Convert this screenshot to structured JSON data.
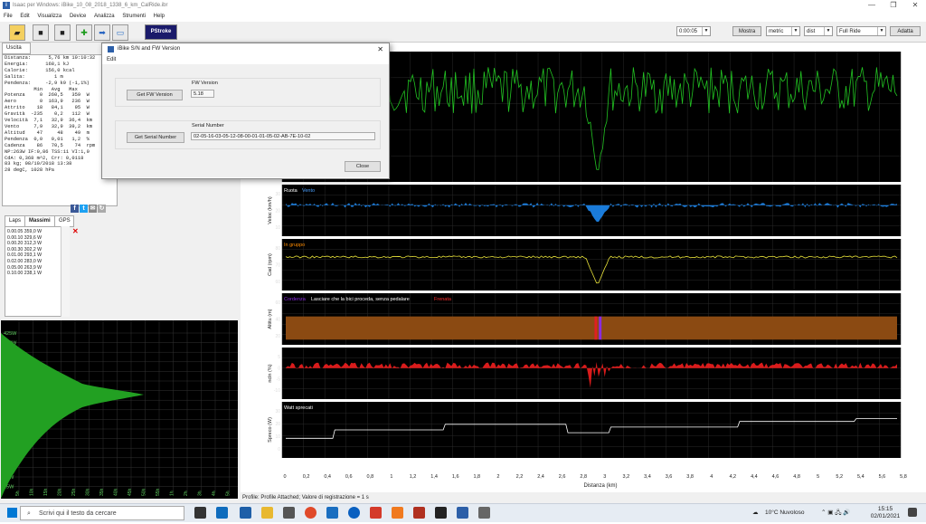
{
  "window": {
    "title": "Isaac per Windows: iBike_10_08_2018_1338_6_km_CalRide.ibr",
    "minimize": "—",
    "maximize": "❐",
    "close": "✕"
  },
  "menu": [
    "File",
    "Edit",
    "Visualizza",
    "Device",
    "Analizza",
    "Strumenti",
    "Help"
  ],
  "toolbar": {
    "pstroke_label": "PStroke",
    "time_value": "0:00:05",
    "mostra_label": "Mostra",
    "units_value": "metric",
    "axis_value": "dist",
    "range_value": "Full Ride",
    "adatta_label": "Adatta"
  },
  "left": {
    "tab_uscita": "Uscita",
    "tab_n": "N",
    "stats_lines": [
      "Distanza:      5,76 km 10:10:32",
      "Energia:      168,1 kJ",
      "Calorie:      156,0 kcal",
      "Salita:          1 m",
      "Pendenza:     -2,9 k9 (-1,1%)",
      "          Min   Avg   Max",
      "Potenza     0  260,5   359  W",
      "Aero        0  163,9   236  W",
      "Attrito    18   84,1    95  W",
      "Gravità  -235    0,2   112  W",
      "Velocità  7,1   32,9  36,4  km",
      "Vento     7,9   32,9  39,2  km",
      "Altitud    47     48    49  m",
      "Pendenza  0,0   0,01   1,2  %",
      "Cadenza    86   70,5    74  rpm",
      "NP:263W IF:0,86 TSS:11 VI:1,0",
      "CdA: 0,368 m^2, Crr: 0,0118",
      "83 kg; 08/10/2018 13:38",
      "28 degC, 1028 hPa"
    ],
    "laps_tab": "Laps",
    "massimi_tab": "Massimi",
    "gps_tab": "GPS",
    "massimi": [
      "0.00.05 359,0 W",
      "0.00.10 329,6 W",
      "0.00.20 312,3 W",
      "0.00.30 302,2 W",
      "0.01.00 293,1 W",
      "0.02.00 283,0 W",
      "0.05.00 263,9 W",
      "0.10.00 238,1 W"
    ],
    "hist_y_labels": [
      "425W",
      "400W",
      "375W",
      "350W",
      "325W",
      "300W",
      "275W",
      "250W",
      "225W",
      "200W",
      "175W",
      "150W",
      "125W",
      "100W",
      "75W",
      "50W",
      "25W"
    ],
    "hist_x_labels": [
      "5h",
      "10h",
      "15h",
      "20h",
      "25h",
      "30h",
      "35h",
      "40h",
      "45h",
      "50h",
      "55h",
      "1h",
      "2h",
      "3h",
      "4h",
      "5h"
    ]
  },
  "dialog": {
    "title": "iBike S/N and FW Version",
    "edit_menu": "Edit",
    "fw_label": "FW Version",
    "fw_button": "Get FW Version",
    "fw_value": "5.18",
    "sn_label": "Serial Number",
    "sn_button": "Get Serial Number",
    "sn_value": "02-05-16-03-05-12-08-00-01-01-05-02-AB-7E-10-02",
    "close_label": "Close"
  },
  "charts": {
    "panels": [
      {
        "ylabel": "",
        "title": "",
        "color": "#22c422"
      },
      {
        "ylabel": "Veloc (km/h)",
        "title": "Ruota",
        "title2": "Vento",
        "color": "#1e90ff",
        "ticks": [
          "30",
          "20",
          "10"
        ]
      },
      {
        "ylabel": "Cad (rpm)",
        "title": "In gruppo",
        "color": "#e8e23a",
        "ticks": [
          "80",
          "70",
          "60"
        ]
      },
      {
        "ylabel": "Altitu (m)",
        "title": "Cordenza",
        "title_mid": "Lasciare che la bici proceda, senza pedalare",
        "title_end": "Frenata",
        "color": "#8b4a12",
        "ticks": [
          "60",
          "40",
          "20"
        ]
      },
      {
        "ylabel": "ncln (%)",
        "title": "",
        "color": "#ff2020",
        "ticks": [
          "5",
          "0",
          "-5",
          "-10"
        ]
      },
      {
        "ylabel": "Spreco (W)",
        "title": "Watt sprecati",
        "color": "#ffffff",
        "ticks": [
          "30",
          "20",
          "10",
          "0"
        ]
      }
    ],
    "x_ticks": [
      "0",
      "0,2",
      "0,4",
      "0,6",
      "0,8",
      "1",
      "1,2",
      "1,4",
      "1,6",
      "1,8",
      "2",
      "2,2",
      "2,4",
      "2,6",
      "2,8",
      "3",
      "3,2",
      "3,4",
      "3,6",
      "3,8",
      "4",
      "4,2",
      "4,4",
      "4,6",
      "4,8",
      "5",
      "5,2",
      "5,4",
      "5,6",
      "5,8"
    ],
    "xlabel": "Distanza (km)",
    "status": "Profile: Profile Attached; Valore di registrazione = 1 s"
  },
  "taskbar": {
    "search_placeholder": "Scrivi qui il testo da cercare",
    "weather": "10°C  Nuvoloso",
    "time": "15:15",
    "date": "02/01/2021"
  }
}
